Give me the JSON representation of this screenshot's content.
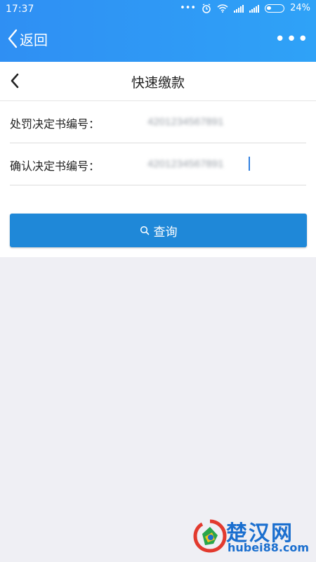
{
  "status_bar": {
    "time": "17:37",
    "battery": "24%"
  },
  "app_bar": {
    "back_label": "返回",
    "more_label": "•••"
  },
  "page": {
    "title": "快速缴款"
  },
  "form": {
    "row1": {
      "label": "处罚决定书编号：",
      "value": "4201234567891"
    },
    "row2": {
      "label": "确认决定书编号：",
      "value": "4201234567891"
    }
  },
  "query_button": {
    "label": "查询"
  },
  "watermark": {
    "name": "楚汉网",
    "url": "hubei88.com"
  },
  "colors": {
    "header": "#2f8ff3",
    "button": "#1f88d8",
    "background": "#efeff4"
  }
}
